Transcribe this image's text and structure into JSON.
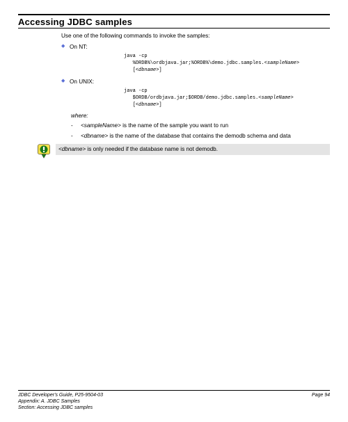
{
  "heading": "Accessing JDBC samples",
  "intro": "Use one of the following commands to invoke the samples:",
  "bullets": {
    "nt": {
      "label": "On NT:"
    },
    "unix": {
      "label": "On UNIX:"
    }
  },
  "code": {
    "nt_line1": "java -cp",
    "nt_line2_a": "   %ORDB%\\ordbjava.jar;%ORDB%\\demo.jdbc.samples.<",
    "nt_line2_b": "sampleName",
    "nt_line2_c": ">",
    "nt_line3_a": "   [<",
    "nt_line3_b": "dbname",
    "nt_line3_c": ">]",
    "ux_line1": "java -cp",
    "ux_line2_a": "   $ORDB/ordbjava.jar;$ORDB/demo.jdbc.samples.<",
    "ux_line2_b": "sampleName",
    "ux_line2_c": ">",
    "ux_line3_a": "   [<",
    "ux_line3_b": "dbname",
    "ux_line3_c": ">]"
  },
  "where_label": "where:",
  "defs": {
    "sample": {
      "var": "<sampleName>",
      "rest": " is the name of the sample you want to run"
    },
    "dbname": {
      "var": "<dbname>",
      "rest": " is the name of the database that contains the demodb schema and data"
    }
  },
  "note": {
    "var": "<dbname>",
    "rest": " is only needed if the database name is not demodb."
  },
  "footer": {
    "line1": "JDBC Developer's Guide, P25-9504-03",
    "line2": "Appendix: A. JDBC Samples",
    "line3": "Section: Accessing JDBC samples",
    "page": "Page 94"
  }
}
